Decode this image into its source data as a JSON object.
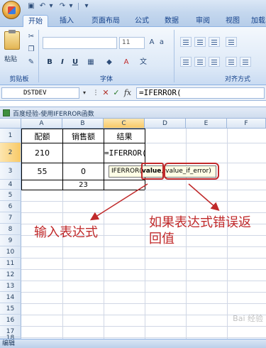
{
  "quick_access": {
    "undo_icon": "undo-icon",
    "redo_icon": "redo-icon",
    "save_icon": "save-icon"
  },
  "tabs": [
    {
      "label": "开始",
      "active": true
    },
    {
      "label": "插入"
    },
    {
      "label": "页面布局"
    },
    {
      "label": "公式"
    },
    {
      "label": "数据"
    },
    {
      "label": "审阅"
    },
    {
      "label": "视图"
    },
    {
      "label": "加载"
    }
  ],
  "ribbon": {
    "paste_label": "粘贴",
    "clipboard_label": "剪贴板",
    "font_label": "字体",
    "font_size": "11",
    "align_label": "对齐方式",
    "bold": "B",
    "italic": "I",
    "underline": "U"
  },
  "formula_bar": {
    "name_box": "DSTDEV",
    "cancel": "✕",
    "enter": "✓",
    "fx": "fx",
    "formula": "=IFERROR("
  },
  "workbook": {
    "title": "百度经验-使用IFERROR函数"
  },
  "grid": {
    "columns": [
      "A",
      "B",
      "C",
      "D",
      "E",
      "F"
    ],
    "rows": [
      "1",
      "2",
      "3",
      "4",
      "5",
      "6",
      "7",
      "8",
      "9",
      "10",
      "11",
      "12",
      "13",
      "14",
      "15",
      "16",
      "17",
      "18",
      "19"
    ],
    "cells": {
      "A1": "配额",
      "B1": "销售额",
      "C1": "结果",
      "A2": "210",
      "C2": "=IFERROR(",
      "A3": "55",
      "B3": "0",
      "B4": "23"
    }
  },
  "tooltip": {
    "fn": "IFERROR(",
    "arg1": "value",
    "sep": ", ",
    "arg2": "value_if_error)"
  },
  "annotations": {
    "left": "输入表达式",
    "right_line1": "如果表达式错误返",
    "right_line2": "回值",
    "color": "#c0292a"
  },
  "status_bar": {
    "mode": "编辑"
  },
  "watermark": "Bai 经验"
}
